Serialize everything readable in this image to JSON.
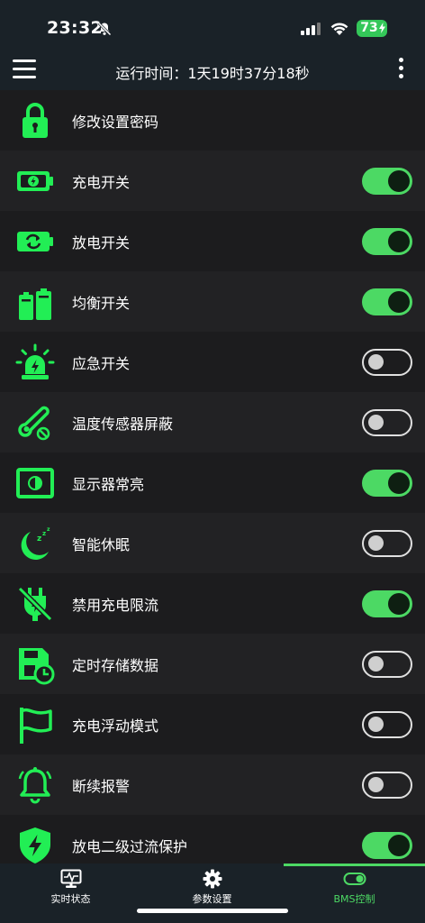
{
  "status_bar": {
    "time": "23:32",
    "battery": "73"
  },
  "header": {
    "runtime": "运行时间：1天19时37分18秒"
  },
  "settings": [
    {
      "label": "修改设置密码",
      "icon": "lock-icon"
    },
    {
      "label": "充电开关",
      "icon": "battery-charge-icon",
      "enabled": true
    },
    {
      "label": "放电开关",
      "icon": "battery-discharge-icon",
      "enabled": true
    },
    {
      "label": "均衡开关",
      "icon": "battery-balance-icon",
      "enabled": true
    },
    {
      "label": "应急开关",
      "icon": "emergency-light-icon",
      "enabled": false
    },
    {
      "label": "温度传感器屏蔽",
      "icon": "temperature-sensor-icon",
      "enabled": false
    },
    {
      "label": "显示器常亮",
      "icon": "display-icon",
      "enabled": true
    },
    {
      "label": "智能休眠",
      "icon": "sleep-moon-icon",
      "enabled": false
    },
    {
      "label": "禁用充电限流",
      "icon": "plug-disabled-icon",
      "enabled": true
    },
    {
      "label": "定时存储数据",
      "icon": "save-timer-icon",
      "enabled": false
    },
    {
      "label": "充电浮动模式",
      "icon": "flag-icon",
      "enabled": false
    },
    {
      "label": "断续报警",
      "icon": "alarm-bell-icon",
      "enabled": false
    },
    {
      "label": "放电二级过流保护",
      "icon": "shield-bolt-icon",
      "enabled": true
    }
  ],
  "tabs": [
    {
      "label": "实时状态",
      "icon": "monitor-icon",
      "active": false
    },
    {
      "label": "参数设置",
      "icon": "gear-icon",
      "active": false
    },
    {
      "label": "BMS控制",
      "icon": "toggle-icon",
      "active": true
    }
  ],
  "colors": {
    "accent": "#4cd964",
    "background": "#1c1c1e",
    "bar": "#1a2228"
  }
}
